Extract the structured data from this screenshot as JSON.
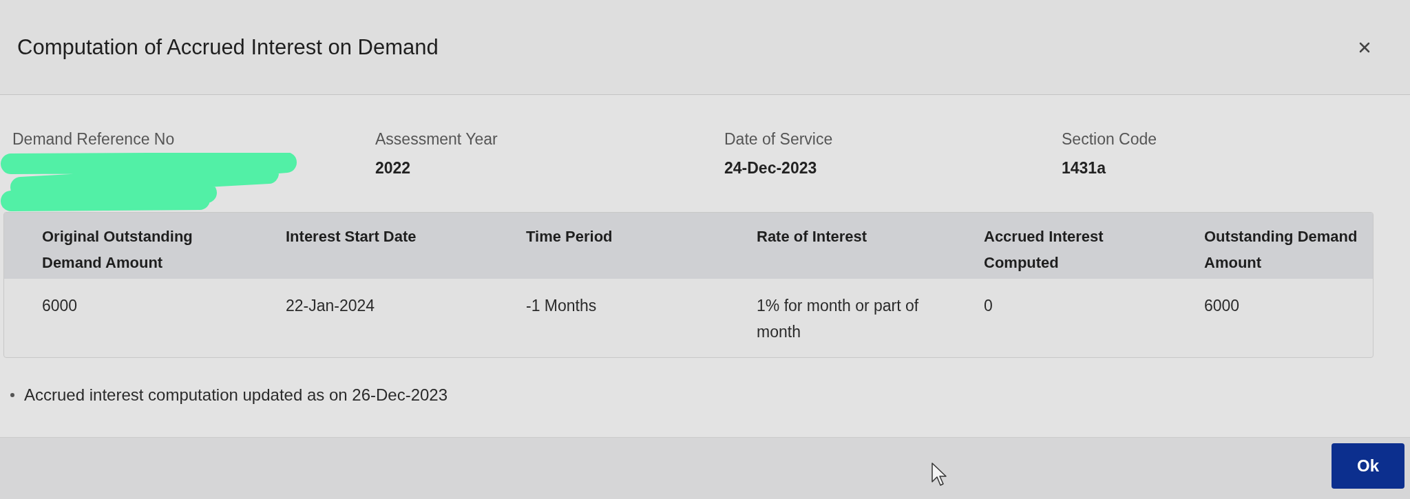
{
  "dialog": {
    "title": "Computation of Accrued Interest on Demand"
  },
  "fields": [
    {
      "label": "Demand Reference No",
      "redacted": true
    },
    {
      "label": "Assessment Year",
      "value": "2022"
    },
    {
      "label": "Date of Service",
      "value": "24-Dec-2023"
    },
    {
      "label": "Section Code",
      "value": "1431a"
    }
  ],
  "table": {
    "columns": [
      "Original Outstanding Demand Amount",
      "Interest Start Date",
      "Time Period",
      "Rate of Interest",
      "Accrued Interest Computed",
      "Outstanding Demand Amount"
    ],
    "rows": [
      [
        "6000",
        "22-Jan-2024",
        "-1 Months",
        "1% for month or part of month",
        "0",
        "6000"
      ]
    ]
  },
  "notes": [
    "Accrued interest computation updated as on 26-Dec-2023"
  ],
  "footer": {
    "buttons": [
      {
        "label": "Ok",
        "kind": "primary"
      }
    ]
  }
}
